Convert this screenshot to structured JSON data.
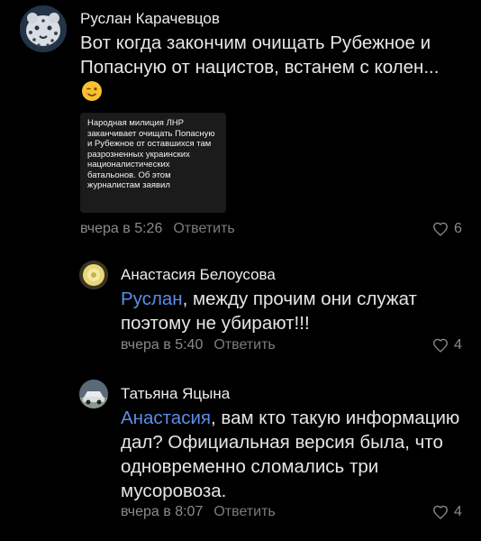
{
  "comments": [
    {
      "author": "Руслан Карачевцов",
      "text": "Вот когда закончим очищать Рубежное и Попасную от нацистов, встанем с колен...",
      "emoji": "winking-face-emoji",
      "attachment": {
        "text": "Народная милиция ЛНР заканчивает очищать Попасную и Рубежное от оставшихся там разрозненных украинских националистических батальонов. Об этом журналистам заявил"
      },
      "time": "вчера в 5:26",
      "reply_label": "Ответить",
      "likes": "6"
    },
    {
      "author": "Анастасия Белоусова",
      "mention": "Руслан",
      "text": ", между прочим они служат поэтому не убирают!!!",
      "time": "вчера в 5:40",
      "reply_label": "Ответить",
      "likes": "4"
    },
    {
      "author": "Татьяна Яцына",
      "mention": "Анастасия",
      "text": ", вам кто такую информацию дал? Официальная версия была, что одновременно сломались три мусоровоза.",
      "time": "вчера в 8:07",
      "reply_label": "Ответить",
      "likes": "4"
    }
  ],
  "colors": {
    "background": "#000000",
    "mention": "#5b8ee8",
    "meta": "#8a8a8a"
  }
}
